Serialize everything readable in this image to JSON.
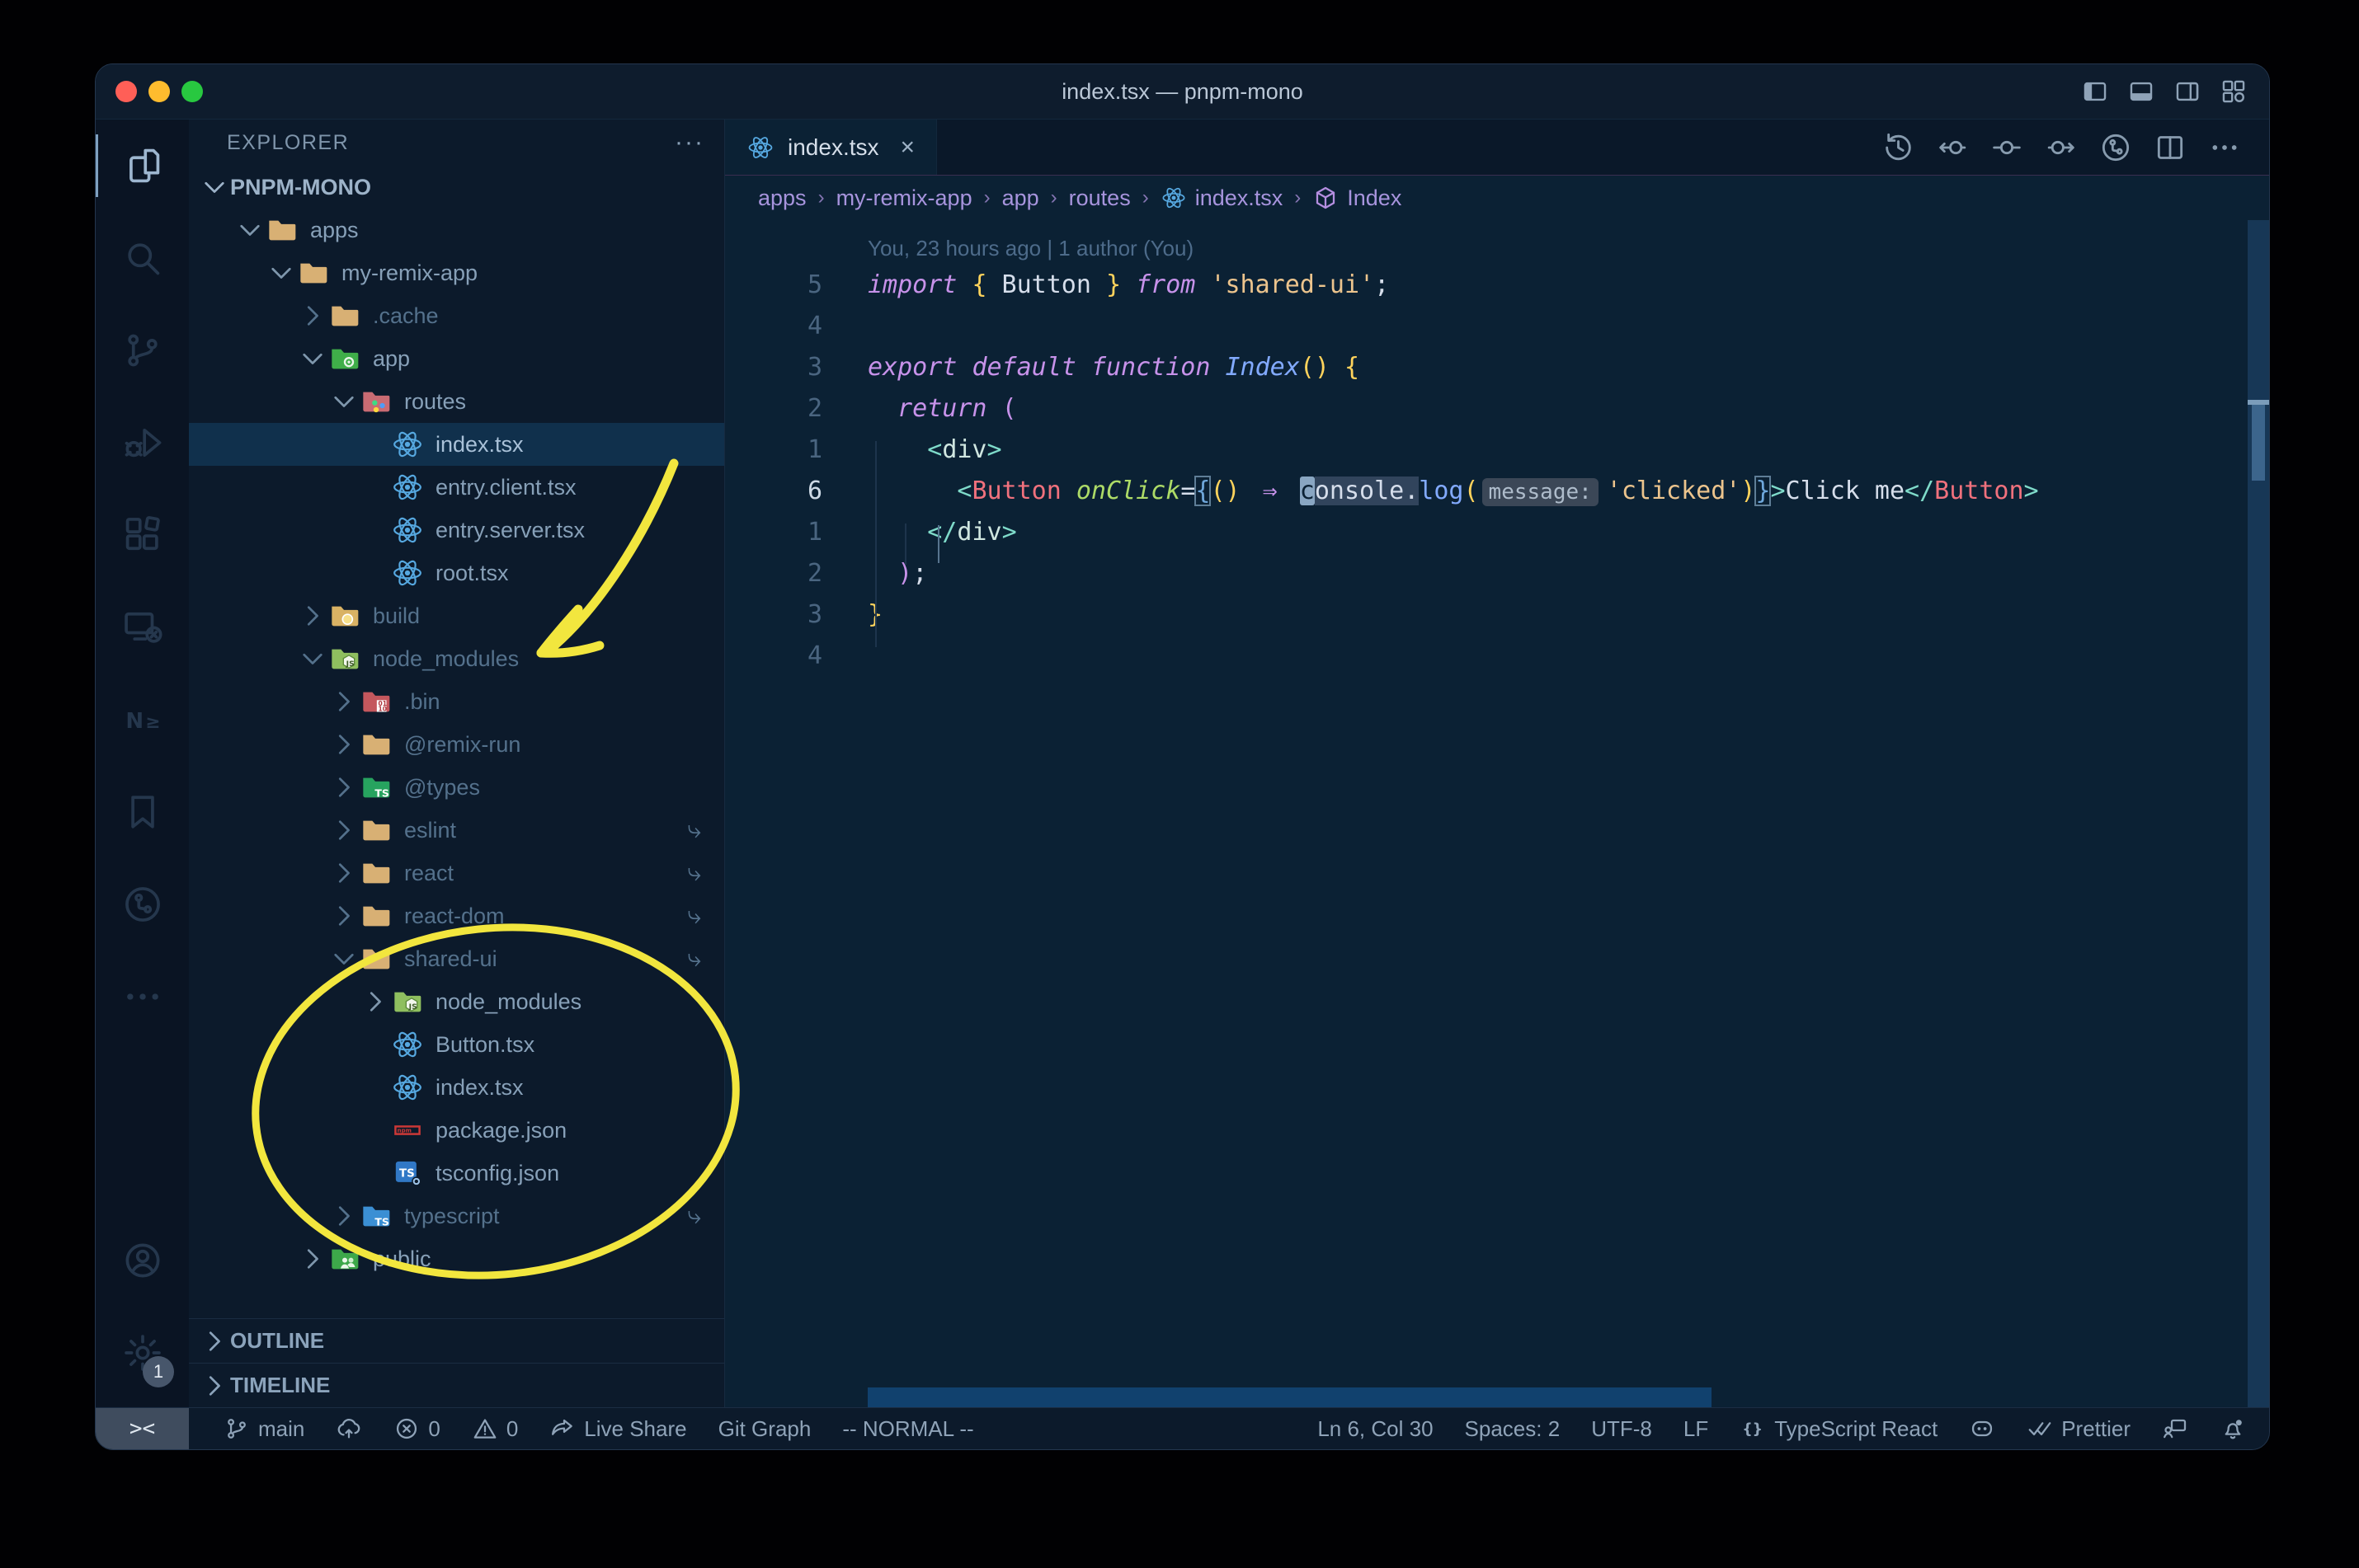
{
  "window": {
    "title": "index.tsx — pnpm-mono",
    "controls": [
      "close",
      "minimize",
      "zoom"
    ],
    "layout_controls": [
      {
        "icon": "panel-left"
      },
      {
        "icon": "panel-bottom"
      },
      {
        "icon": "panel-right"
      },
      {
        "icon": "customize-layout"
      }
    ]
  },
  "activity_bar": {
    "items": [
      {
        "icon": "explorer",
        "active": true
      },
      {
        "icon": "search",
        "active": false
      },
      {
        "icon": "source-control",
        "active": false
      },
      {
        "icon": "run-debug",
        "active": false
      },
      {
        "icon": "extensions",
        "active": false
      },
      {
        "icon": "remote-explorer",
        "active": false
      },
      {
        "icon": "nx-console",
        "active": false
      },
      {
        "icon": "bookmarks",
        "active": false
      },
      {
        "icon": "gitlens",
        "active": false
      },
      {
        "icon": "more",
        "active": false
      }
    ],
    "bottom": [
      {
        "icon": "account"
      },
      {
        "icon": "settings",
        "badge": "1"
      }
    ]
  },
  "sidebar": {
    "header": {
      "title": "EXPLORER",
      "more": "···"
    },
    "root": {
      "label": "PNPM-MONO"
    },
    "tree": [
      {
        "label": "apps",
        "level": 1,
        "chevron": "down",
        "icon": "folder",
        "muted": false,
        "selected": false,
        "symlink": false
      },
      {
        "label": "my-remix-app",
        "level": 2,
        "chevron": "down",
        "icon": "folder",
        "muted": false,
        "selected": false,
        "symlink": false
      },
      {
        "label": ".cache",
        "level": 3,
        "chevron": "right",
        "icon": "folder",
        "muted": true,
        "selected": false,
        "symlink": false
      },
      {
        "label": "app",
        "level": 3,
        "chevron": "down",
        "icon": "folder-app",
        "muted": false,
        "selected": false,
        "symlink": false
      },
      {
        "label": "routes",
        "level": 4,
        "chevron": "down",
        "icon": "folder-routes",
        "muted": false,
        "selected": false,
        "symlink": false
      },
      {
        "label": "index.tsx",
        "level": 5,
        "chevron": "none",
        "icon": "react",
        "muted": false,
        "selected": true,
        "symlink": false
      },
      {
        "label": "entry.client.tsx",
        "level": 5,
        "chevron": "none",
        "icon": "react",
        "muted": false,
        "selected": false,
        "symlink": false
      },
      {
        "label": "entry.server.tsx",
        "level": 5,
        "chevron": "none",
        "icon": "react",
        "muted": false,
        "selected": false,
        "symlink": false
      },
      {
        "label": "root.tsx",
        "level": 5,
        "chevron": "none",
        "icon": "react",
        "muted": false,
        "selected": false,
        "symlink": false
      },
      {
        "label": "build",
        "level": 3,
        "chevron": "right",
        "icon": "folder-build",
        "muted": true,
        "selected": false,
        "symlink": false
      },
      {
        "label": "node_modules",
        "level": 3,
        "chevron": "down",
        "icon": "folder-node",
        "muted": true,
        "selected": false,
        "symlink": false
      },
      {
        "label": ".bin",
        "level": 4,
        "chevron": "right",
        "icon": "folder-bin",
        "muted": true,
        "selected": false,
        "symlink": false
      },
      {
        "label": "@remix-run",
        "level": 4,
        "chevron": "right",
        "icon": "folder",
        "muted": true,
        "selected": false,
        "symlink": false
      },
      {
        "label": "@types",
        "level": 4,
        "chevron": "right",
        "icon": "folder-types",
        "muted": true,
        "selected": false,
        "symlink": false
      },
      {
        "label": "eslint",
        "level": 4,
        "chevron": "right",
        "icon": "folder",
        "muted": true,
        "selected": false,
        "symlink": true
      },
      {
        "label": "react",
        "level": 4,
        "chevron": "right",
        "icon": "folder",
        "muted": true,
        "selected": false,
        "symlink": true
      },
      {
        "label": "react-dom",
        "level": 4,
        "chevron": "right",
        "icon": "folder",
        "muted": true,
        "selected": false,
        "symlink": true
      },
      {
        "label": "shared-ui",
        "level": 4,
        "chevron": "down",
        "icon": "folder",
        "muted": true,
        "selected": false,
        "symlink": true
      },
      {
        "label": "node_modules",
        "level": 5,
        "chevron": "right",
        "icon": "folder-node",
        "muted": false,
        "selected": false,
        "symlink": false
      },
      {
        "label": "Button.tsx",
        "level": 5,
        "chevron": "none",
        "icon": "react",
        "muted": false,
        "selected": false,
        "symlink": false
      },
      {
        "label": "index.tsx",
        "level": 5,
        "chevron": "none",
        "icon": "react",
        "muted": false,
        "selected": false,
        "symlink": false
      },
      {
        "label": "package.json",
        "level": 5,
        "chevron": "none",
        "icon": "npm",
        "muted": false,
        "selected": false,
        "symlink": false
      },
      {
        "label": "tsconfig.json",
        "level": 5,
        "chevron": "none",
        "icon": "ts-config",
        "muted": false,
        "selected": false,
        "symlink": false
      },
      {
        "label": "typescript",
        "level": 4,
        "chevron": "right",
        "icon": "folder-ts",
        "muted": true,
        "selected": false,
        "symlink": true
      },
      {
        "label": "public",
        "level": 3,
        "chevron": "right",
        "icon": "folder-public",
        "muted": false,
        "selected": false,
        "symlink": false
      }
    ],
    "sections": [
      {
        "label": "OUTLINE"
      },
      {
        "label": "TIMELINE"
      }
    ]
  },
  "editor": {
    "tab": {
      "label": "index.tsx",
      "icon": "react",
      "close": "×"
    },
    "actions": [
      {
        "icon": "timeline-history"
      },
      {
        "icon": "previous-change"
      },
      {
        "icon": "current-change"
      },
      {
        "icon": "next-change"
      },
      {
        "icon": "branch-graph"
      },
      {
        "icon": "split-editor"
      },
      {
        "icon": "more-actions"
      }
    ],
    "breadcrumbs": [
      {
        "label": "apps",
        "icon": ""
      },
      {
        "label": "my-remix-app",
        "icon": ""
      },
      {
        "label": "app",
        "icon": ""
      },
      {
        "label": "routes",
        "icon": ""
      },
      {
        "label": "index.tsx",
        "icon": "react"
      },
      {
        "label": "Index",
        "icon": "symbol-module"
      }
    ],
    "blame": "You, 23 hours ago | 1 author (You)",
    "gutter": [
      "5",
      "4",
      "3",
      "2",
      "1",
      "6",
      "1",
      "2",
      "3",
      "4"
    ],
    "active_line_index": 5,
    "lines": [
      [
        [
          "kw",
          "import"
        ],
        [
          "c0",
          " "
        ],
        [
          "br",
          "{"
        ],
        [
          "c0",
          " Button "
        ],
        [
          "br",
          "}"
        ],
        [
          "c0",
          " "
        ],
        [
          "kw",
          "from"
        ],
        [
          "c0",
          " "
        ],
        [
          "st",
          "'shared-ui'"
        ],
        [
          "c0",
          ";"
        ]
      ],
      [],
      [
        [
          "kw",
          "export"
        ],
        [
          "c0",
          " "
        ],
        [
          "kw",
          "default"
        ],
        [
          "c0",
          " "
        ],
        [
          "kw",
          "function"
        ],
        [
          "c0",
          " "
        ],
        [
          "fnI",
          "Index"
        ],
        [
          "br",
          "()"
        ],
        [
          "c0",
          " "
        ],
        [
          "br",
          "{"
        ]
      ],
      [
        [
          "c0",
          "  "
        ],
        [
          "kw",
          "return"
        ],
        [
          "c0",
          " "
        ],
        [
          "mg",
          "("
        ]
      ],
      [
        [
          "c0",
          "    "
        ],
        [
          "tg",
          "<"
        ],
        [
          "tn",
          "div"
        ],
        [
          "tg",
          ">"
        ]
      ],
      [
        [
          "c0",
          "      "
        ],
        [
          "tg",
          "<"
        ],
        [
          "cp",
          "Button"
        ],
        [
          "c0",
          " "
        ],
        [
          "at",
          "onClick"
        ],
        [
          "c0",
          "="
        ],
        [
          "bm",
          "{"
        ],
        [
          "br",
          "()"
        ],
        [
          "c0",
          " "
        ],
        [
          "ar",
          "⇒"
        ],
        [
          "c0",
          " "
        ],
        [
          "cur",
          "c"
        ],
        [
          "whl",
          "onsole."
        ],
        [
          "fn",
          "log"
        ],
        [
          "br",
          "("
        ],
        [
          "inl",
          "message:"
        ],
        [
          "st",
          "'clicked'"
        ],
        [
          "br",
          ")"
        ],
        [
          "bm",
          "}"
        ],
        [
          "tg",
          ">"
        ],
        [
          "c0",
          "Click me"
        ],
        [
          "tg",
          "</"
        ],
        [
          "cp",
          "Button"
        ],
        [
          "tg",
          ">"
        ]
      ],
      [
        [
          "c0",
          "    "
        ],
        [
          "tg",
          "</"
        ],
        [
          "tn",
          "div"
        ],
        [
          "tg",
          ">"
        ]
      ],
      [
        [
          "c0",
          "  "
        ],
        [
          "mg",
          ")"
        ],
        [
          "c0",
          ";"
        ]
      ],
      [
        [
          "br",
          "}"
        ]
      ],
      []
    ]
  },
  "status_bar": {
    "left": [
      {
        "icon": "remote-window",
        "label": "><",
        "box": true
      },
      {
        "icon": "git-branch",
        "label": "main"
      },
      {
        "icon": "publish-sync",
        "label": ""
      },
      {
        "icon": "errors",
        "label": "0"
      },
      {
        "icon": "warnings",
        "label": "0"
      },
      {
        "icon": "live-share",
        "label": "Live Share"
      },
      {
        "icon": "",
        "label": "Git Graph"
      },
      {
        "icon": "",
        "label": "-- NORMAL --"
      }
    ],
    "right": [
      {
        "icon": "",
        "label": "Ln 6, Col 30"
      },
      {
        "icon": "",
        "label": "Spaces: 2"
      },
      {
        "icon": "",
        "label": "UTF-8"
      },
      {
        "icon": "",
        "label": "LF"
      },
      {
        "icon": "braces",
        "label": "TypeScript React"
      },
      {
        "icon": "copilot",
        "label": ""
      },
      {
        "icon": "double-check",
        "label": "Prettier"
      },
      {
        "icon": "feedback",
        "label": ""
      },
      {
        "icon": "bell-dot",
        "label": ""
      }
    ]
  },
  "colors": {
    "editor_bg": "#0b2134",
    "sidebar_bg": "#0c1a2b",
    "titlebar_bg": "#0e1c2d",
    "activitybar_bg": "#0a1423",
    "statusbar_bg": "#0c1a2b",
    "selection_row": "#10304c",
    "keyword": "#c792ea",
    "string": "#ecc48d",
    "brace": "#ffd35c",
    "function": "#82aaff",
    "tag": "#7fdbca",
    "component": "#f0717d",
    "attribute": "#addb67",
    "annotation_yellow": "#f2e63e",
    "traffic_close": "#ff5f57",
    "traffic_min": "#febc2e",
    "traffic_max": "#28c840"
  }
}
